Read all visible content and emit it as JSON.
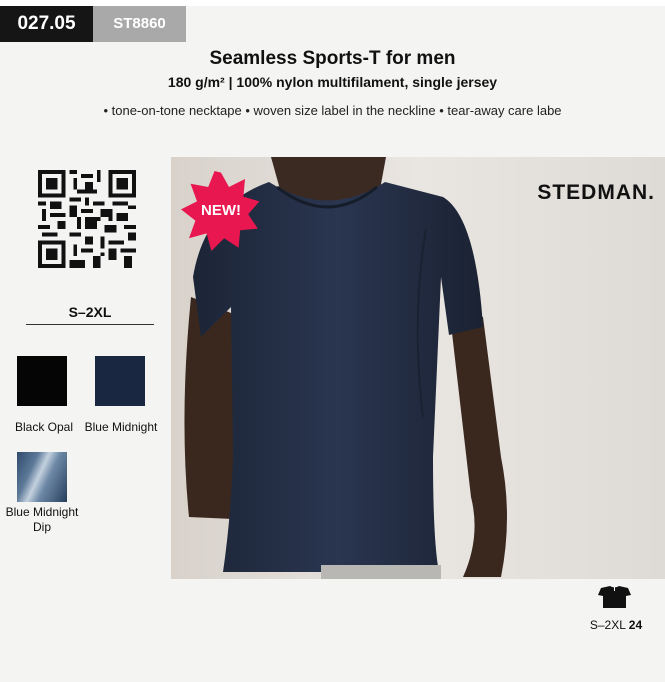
{
  "header": {
    "section_code": "027.05",
    "article_code": "ST8860"
  },
  "product": {
    "title": "Seamless Sports-T for men",
    "subtitle": "180 g/m² | 100% nylon multifilament, single jersey",
    "features": "• tone-on-tone necktape • woven size label in the neckline • tear-away care labe"
  },
  "sizes": {
    "range": "S–2XL"
  },
  "colors": [
    {
      "name": "Black Opal",
      "hex": "#050505"
    },
    {
      "name": "Blue Midnight",
      "hex": "#1a2740"
    },
    {
      "name": "Blue Midnight Dip",
      "hex": "#5e7a99"
    }
  ],
  "photo": {
    "brand": "STEDMAN.",
    "badge": "NEW!",
    "badge_color": "#e8174f"
  },
  "fit": {
    "size_range": "S–2XL",
    "count": "24",
    "icon": "tshirt-icon"
  },
  "icons": {
    "qr": "qr-code-icon"
  }
}
